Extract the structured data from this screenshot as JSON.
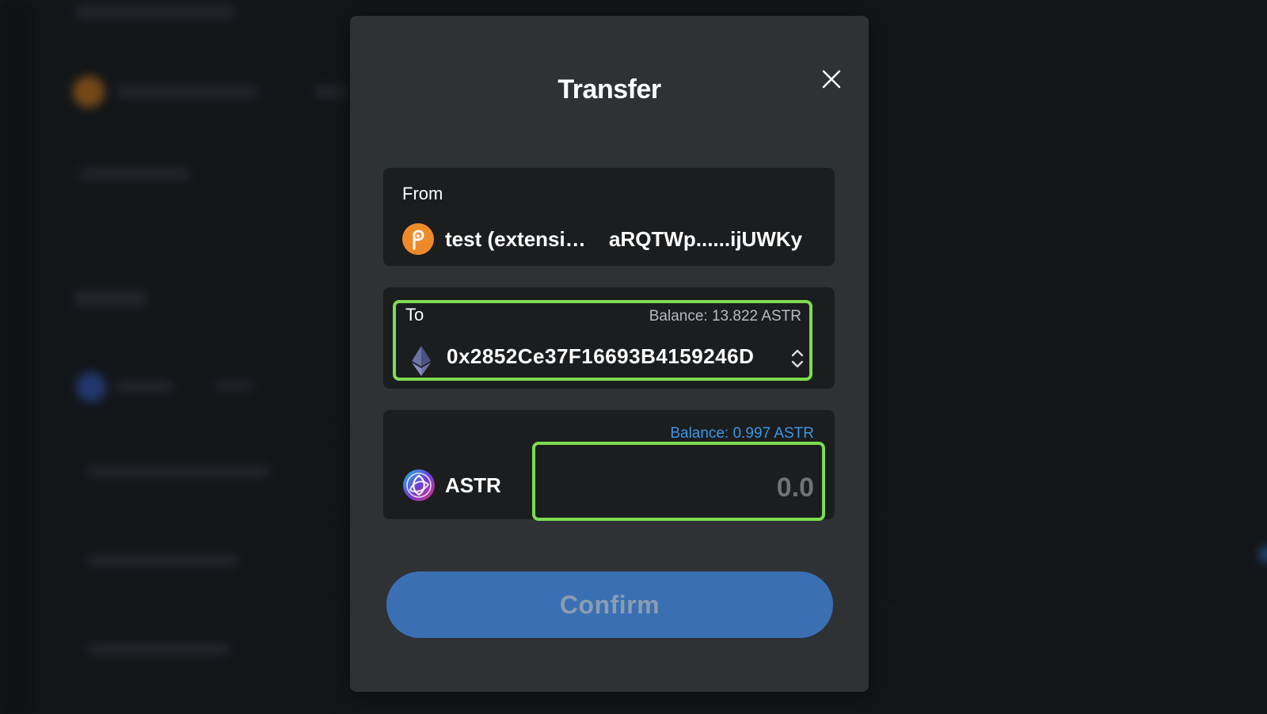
{
  "modal": {
    "title": "Transfer",
    "close_icon": "close-icon"
  },
  "from": {
    "label": "From",
    "account_name": "test (extension)",
    "account_address": "aRQTWp......ijUWKy",
    "icon": "polkadot-icon"
  },
  "to": {
    "label": "To",
    "balance": "Balance: 13.822 ASTR",
    "address": "0x2852Ce37F16693B4159246D",
    "icon": "ethereum-icon",
    "selector_icon": "chevron-up-down-icon"
  },
  "amount": {
    "balance": "Balance: 0.997 ASTR",
    "token": "ASTR",
    "token_icon": "astar-icon",
    "placeholder": "0.0",
    "value": ""
  },
  "confirm_label": "Confirm",
  "colors": {
    "highlight": "#7ddc4f",
    "accent": "#3a6fb3",
    "link": "#3b97e6"
  }
}
